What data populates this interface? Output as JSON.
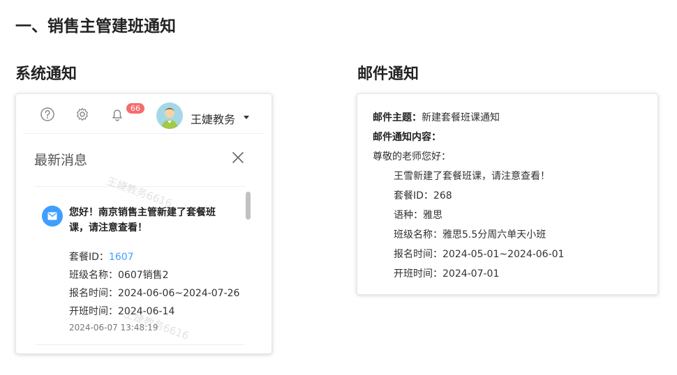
{
  "page_title": "一、销售主管建班通知",
  "sections": {
    "system": "系统通知",
    "email": "邮件通知"
  },
  "system_notice": {
    "badge_count": "66",
    "user_name": "王婕教务",
    "panel_title": "最新消息",
    "watermark": "王婕教务6616",
    "message": {
      "title": "您好！南京销售主管新建了套餐班课，请注意查看！",
      "fields": [
        {
          "label": "套餐ID：",
          "value": "1607"
        },
        {
          "label": "班级名称：",
          "value": "0607销售2"
        },
        {
          "label": "报名时间：",
          "value": "2024-06-06~2024-07-26"
        },
        {
          "label": "开班时间：",
          "value": "2024-06-14"
        }
      ],
      "time": "2024-06-07 13:48:19"
    },
    "colors": {
      "accent": "#409eff",
      "badge": "#f56c6c"
    }
  },
  "email_notice": {
    "subject_label": "邮件主题：",
    "subject_value": "新建套餐班课通知",
    "content_label": "邮件通知内容：",
    "greeting": "尊敬的老师您好：",
    "body": "王雪新建了套餐班课，请注意查看！",
    "fields": [
      {
        "label": "套餐ID：",
        "value": "268"
      },
      {
        "label": "语种：",
        "value": "雅思"
      },
      {
        "label": "班级名称：",
        "value": "雅思5.5分周六单天小班"
      },
      {
        "label": "报名时间：",
        "value": "2024-05-01~2024-06-01"
      },
      {
        "label": "开班时间：",
        "value": "2024-07-01"
      }
    ]
  }
}
